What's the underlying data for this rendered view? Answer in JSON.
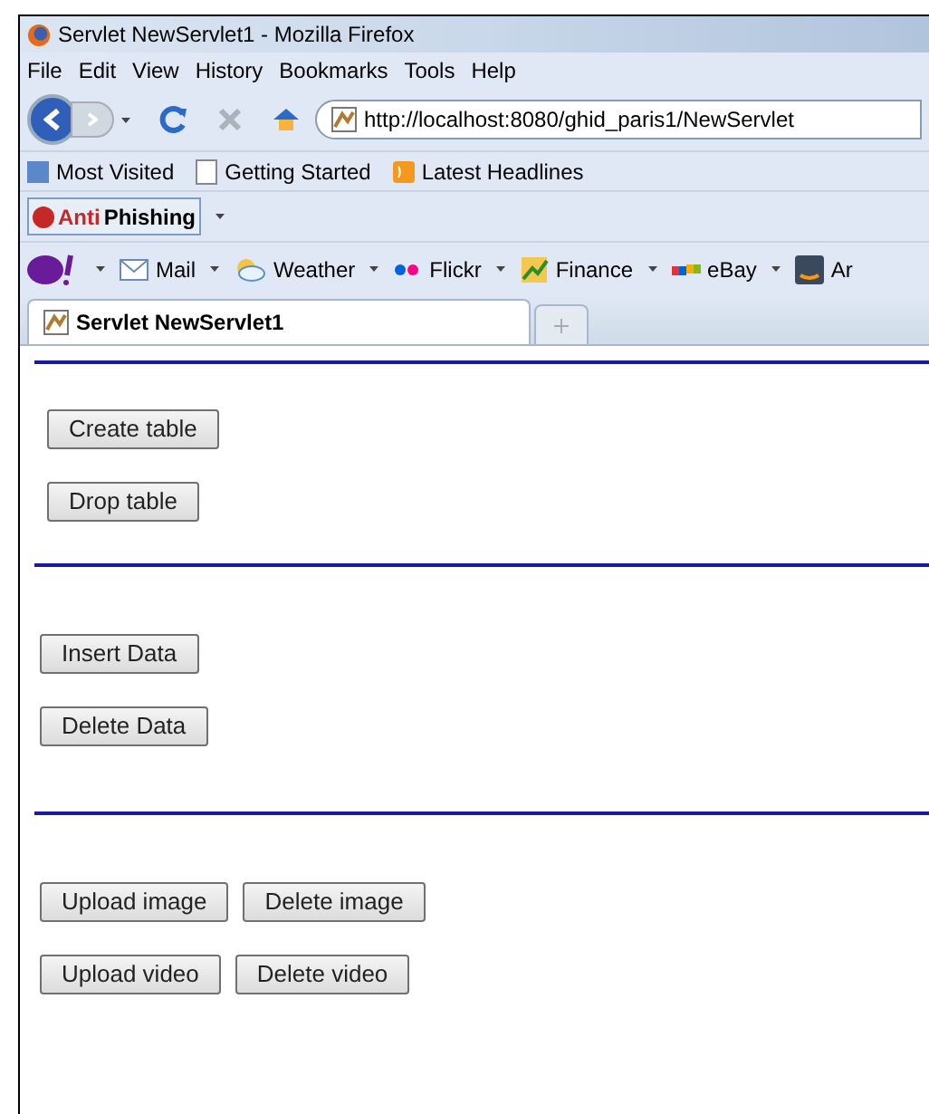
{
  "window": {
    "title": "Servlet NewServlet1 - Mozilla Firefox"
  },
  "menu": [
    "File",
    "Edit",
    "View",
    "History",
    "Bookmarks",
    "Tools",
    "Help"
  ],
  "address": {
    "value": "http://localhost:8080/ghid_paris1/NewServlet"
  },
  "bookmarks": [
    "Most Visited",
    "Getting Started",
    "Latest Headlines"
  ],
  "antiphishing": {
    "part1": "Anti",
    "part2": "Phishing"
  },
  "yahoo_toolbar": [
    {
      "label": "Mail",
      "kind": "mail"
    },
    {
      "label": "Weather",
      "kind": "weather"
    },
    {
      "label": "Flickr",
      "kind": "flickr"
    },
    {
      "label": "Finance",
      "kind": "finance"
    },
    {
      "label": "eBay",
      "kind": "ebay"
    },
    {
      "label": "Ar",
      "kind": "amazon"
    }
  ],
  "tabs": [
    {
      "label": "Servlet NewServlet1",
      "selected": true
    }
  ],
  "sections": [
    {
      "buttons": [
        [
          "Create table"
        ],
        [
          "Drop table"
        ]
      ]
    },
    {
      "buttons": [
        [
          "Insert Data"
        ],
        [
          "Delete Data"
        ]
      ]
    },
    {
      "buttons": [
        [
          "Upload image",
          "Delete image"
        ],
        [
          "Upload video",
          "Delete video"
        ]
      ]
    }
  ]
}
